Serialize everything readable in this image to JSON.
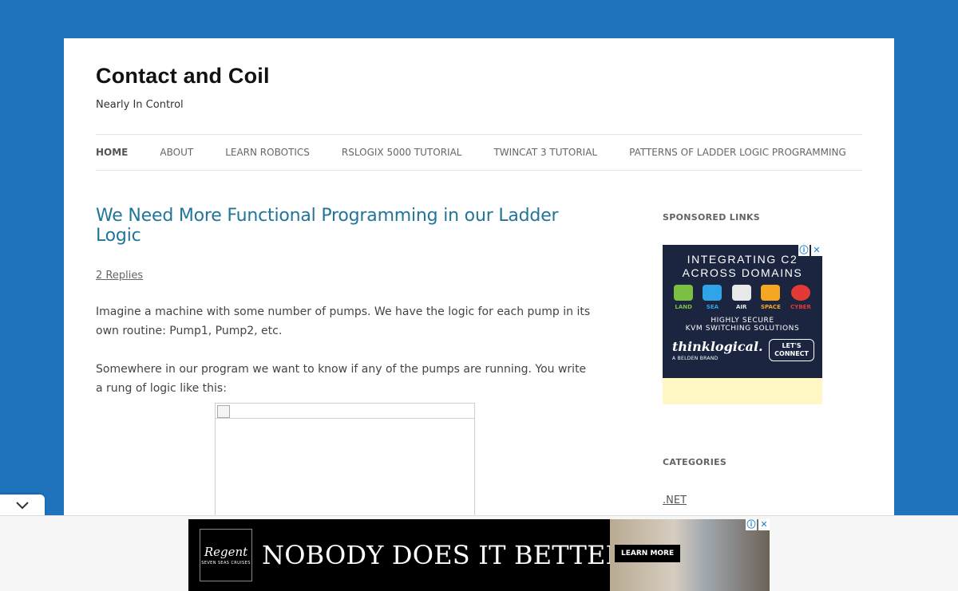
{
  "site": {
    "title": "Contact and Coil",
    "tagline": "Nearly In Control"
  },
  "nav": {
    "items": [
      {
        "label": "HOME",
        "active": true
      },
      {
        "label": "ABOUT"
      },
      {
        "label": "LEARN ROBOTICS"
      },
      {
        "label": "RSLOGIX 5000 TUTORIAL"
      },
      {
        "label": "TWINCAT 3 TUTORIAL"
      },
      {
        "label": "PATTERNS OF LADDER LOGIC PROGRAMMING"
      }
    ]
  },
  "post": {
    "title": "We Need More Functional Programming in our Ladder Logic",
    "replies": "2 Replies",
    "paragraphs": [
      "Imagine a machine with some number of pumps. We have the logic for each pump in its own routine: Pump1, Pump2, etc.",
      "Somewhere in our program we want to know if any of the pumps are running. You write a rung of logic like this:"
    ]
  },
  "sidebar": {
    "sponsored_title": "SPONSORED LINKS",
    "ad": {
      "heading_line1": "INTEGRATING C2",
      "heading_line2": "ACROSS DOMAINS",
      "domains": [
        {
          "label": "LAND",
          "color": "#7bc043"
        },
        {
          "label": "SEA",
          "color": "#2fa4e7"
        },
        {
          "label": "AIR",
          "color": "#e8e8e8"
        },
        {
          "label": "SPACE",
          "color": "#f5a623"
        },
        {
          "label": "CYBER",
          "color": "#e53935"
        }
      ],
      "sub_line1": "HIGHLY SECURE",
      "sub_line2": "KVM SWITCHING SOLUTIONS",
      "brand": "thinklogical.",
      "brand_tag": "A BELDEN BRAND",
      "cta_line1": "LET'S",
      "cta_line2": "CONNECT"
    },
    "categories_title": "CATEGORIES",
    "categories": [
      ".NET"
    ]
  },
  "bottom_ad": {
    "logo_word": "Regent",
    "logo_sub": "SEVEN SEAS CRUISES",
    "headline": "NOBODY DOES IT BETTER™",
    "cta": "LEARN MORE"
  },
  "icons": {
    "collapse": "chevron-down-icon",
    "ad_info": "info-icon",
    "ad_close": "close-icon"
  },
  "colors": {
    "background": "#1f73bd",
    "link": "#21759b",
    "ad_navy": "#1c2540"
  }
}
